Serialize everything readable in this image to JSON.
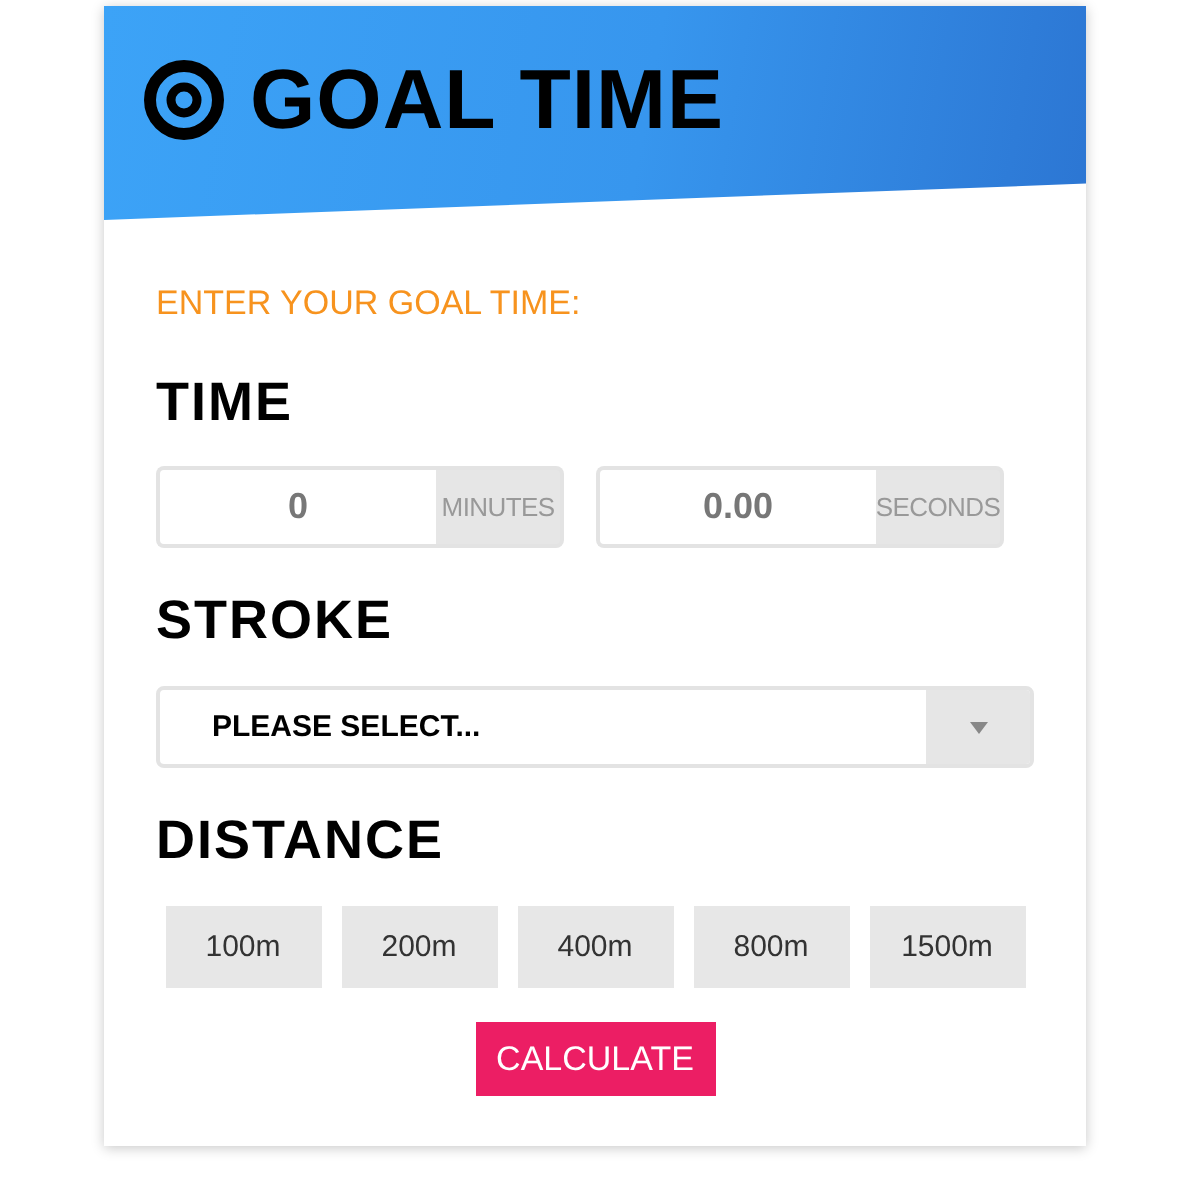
{
  "header": {
    "title": "GOAL TIME"
  },
  "form": {
    "prompt": "ENTER YOUR GOAL TIME:",
    "time": {
      "label": "TIME",
      "fields": [
        {
          "placeholder": "0",
          "unit": "MINUTES"
        },
        {
          "placeholder": "0.00",
          "unit": "SECONDS"
        }
      ]
    },
    "stroke": {
      "label": "STROKE",
      "select": {
        "value": "PLEASE SELECT..."
      }
    },
    "distance": {
      "label": "DISTANCE",
      "options": [
        {
          "label": "100m",
          "selected": false
        },
        {
          "label": "200m",
          "selected": false
        },
        {
          "label": "400m",
          "selected": false
        },
        {
          "label": "800m",
          "selected": false
        },
        {
          "label": "1500m",
          "selected": false
        }
      ]
    },
    "submit": {
      "label": "CALCULATE"
    }
  }
}
